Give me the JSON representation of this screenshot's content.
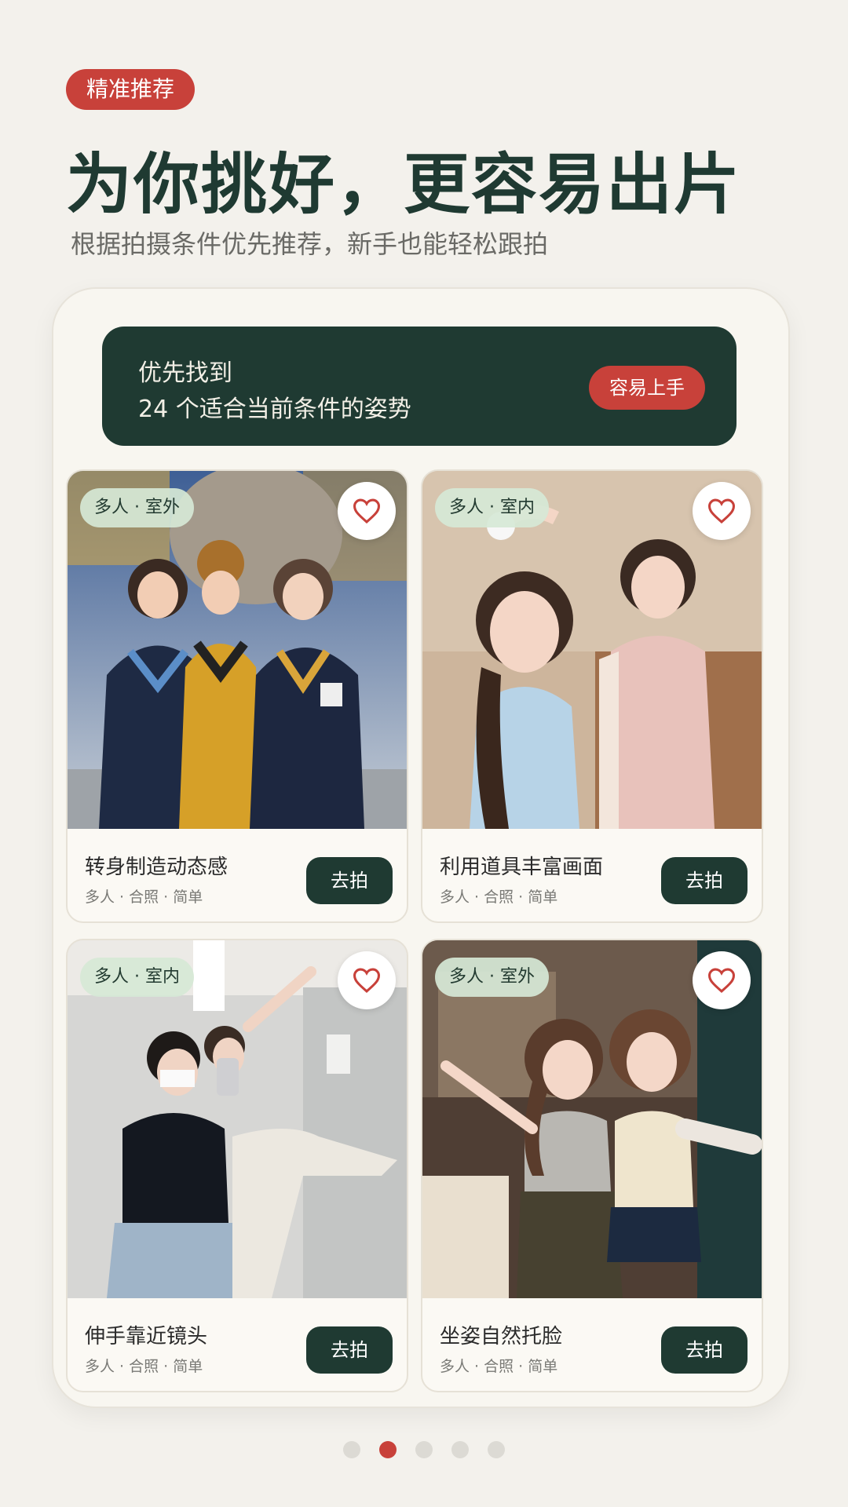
{
  "header": {
    "tag": "精准推荐",
    "title": "为你挑好，更容易出片",
    "subtitle": "根据拍摄条件优先推荐，新手也能轻松跟拍"
  },
  "banner": {
    "line1": "优先找到",
    "line2": "24 个适合当前条件的姿势",
    "badge": "容易上手"
  },
  "cards": [
    {
      "location": "多人 · 室外",
      "title": "转身制造动态感",
      "meta": "多人 · 合照 · 简单",
      "button": "去拍",
      "favorite_icon": "heart-icon"
    },
    {
      "location": "多人 · 室内",
      "title": "利用道具丰富画面",
      "meta": "多人 · 合照 · 简单",
      "button": "去拍",
      "favorite_icon": "heart-icon"
    },
    {
      "location": "多人 · 室内",
      "title": "伸手靠近镜头",
      "meta": "多人 · 合照 · 简单",
      "button": "去拍",
      "favorite_icon": "heart-icon"
    },
    {
      "location": "多人 · 室外",
      "title": "坐姿自然托脸",
      "meta": "多人 · 合照 · 简单",
      "button": "去拍",
      "favorite_icon": "heart-icon"
    }
  ],
  "pagination": {
    "total": 5,
    "active_index": 1
  },
  "colors": {
    "accent": "#c8413a",
    "primary_dark": "#1f3a32",
    "background": "#f3f1ec"
  }
}
